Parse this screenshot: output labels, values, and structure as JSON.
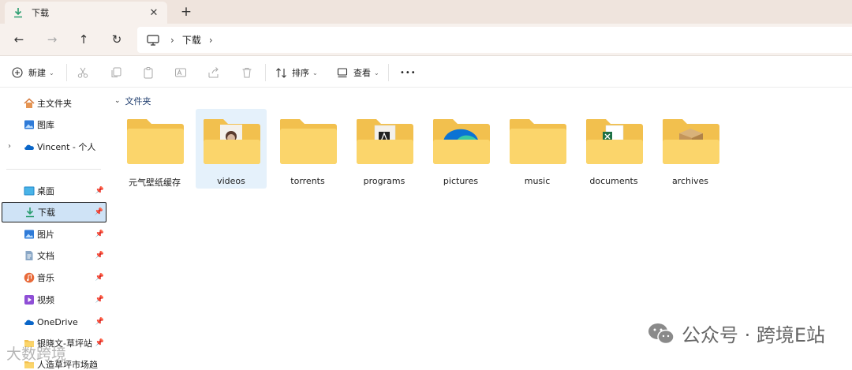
{
  "tab": {
    "title": "下载",
    "close": "✕",
    "new_tab": "+"
  },
  "nav": {
    "back": "←",
    "forward": "→",
    "up": "↑",
    "refresh": "↻"
  },
  "address": {
    "separator": "›",
    "crumbs": [
      "下载"
    ],
    "trail": "›"
  },
  "commands": {
    "new": "新建",
    "sort": "排序",
    "view": "查看",
    "more": "•••"
  },
  "sidebar": {
    "items": [
      {
        "label": "主文件夹",
        "icon": "home-icon"
      },
      {
        "label": "图库",
        "icon": "gallery-icon"
      },
      {
        "label": "Vincent - 个人",
        "icon": "onedrive-icon"
      },
      {
        "label": "桌面",
        "icon": "desktop-icon",
        "pinned": true
      },
      {
        "label": "下载",
        "icon": "download-icon",
        "pinned": true,
        "selected": true
      },
      {
        "label": "图片",
        "icon": "pictures-icon",
        "pinned": true
      },
      {
        "label": "文档",
        "icon": "documents-icon",
        "pinned": true
      },
      {
        "label": "音乐",
        "icon": "music-icon",
        "pinned": true
      },
      {
        "label": "视频",
        "icon": "videos-icon",
        "pinned": true
      },
      {
        "label": "OneDrive",
        "icon": "onedrive-icon",
        "pinned": true
      },
      {
        "label": "银晓文-草坪站",
        "icon": "folder-icon",
        "pinned": true
      },
      {
        "label": "人造草坪市场趋",
        "icon": "folder-icon"
      }
    ]
  },
  "main": {
    "group_label": "文件夹",
    "folders": [
      {
        "name": "元气壁纸缓存",
        "badge": "none"
      },
      {
        "name": "videos",
        "badge": "video-thumbnail",
        "selected": true
      },
      {
        "name": "torrents",
        "badge": "none"
      },
      {
        "name": "programs",
        "badge": "app-thumbnail"
      },
      {
        "name": "pictures",
        "badge": "edge-thumbnail"
      },
      {
        "name": "music",
        "badge": "none"
      },
      {
        "name": "documents",
        "badge": "excel-thumbnail"
      },
      {
        "name": "archives",
        "badge": "box-thumbnail"
      }
    ]
  },
  "watermark": {
    "text": "公众号 · 跨境E站",
    "left_text": "大数跨境"
  },
  "colors": {
    "folder_back": "#f2c04e",
    "folder_front": "#fbd56b",
    "selection": "#cfe3f6",
    "accent": "#0a7ed6"
  }
}
